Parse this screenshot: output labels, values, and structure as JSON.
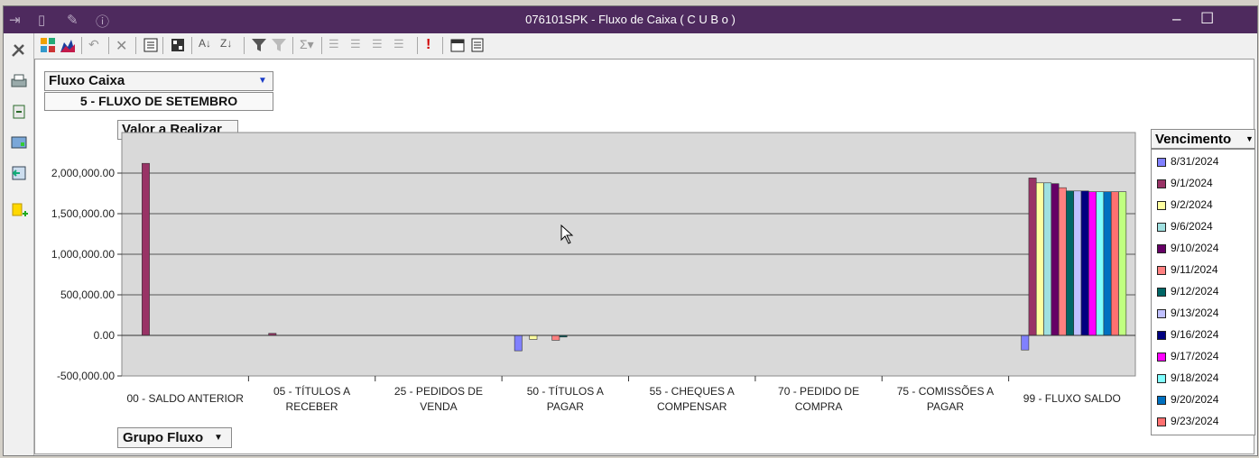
{
  "window": {
    "title": "076101SPK - Fluxo de Caixa ( C U B o )",
    "min_glyph": "–",
    "max_glyph": "☐"
  },
  "filters": {
    "field1_label": "Fluxo Caixa",
    "field1_value": "5 - FLUXO DE SETEMBRO",
    "data_field_label": "Valor a Realizar",
    "category_field_label": "Grupo Fluxo",
    "series_field_label": "Vencimento"
  },
  "colors": {
    "titlebar": "#4e2a5e",
    "plot_background": "#d9d9d9"
  },
  "chart_data": {
    "type": "bar",
    "ylim": [
      -500000,
      2500000
    ],
    "y_ticks": [
      -500000,
      0,
      500000,
      1000000,
      1500000,
      2000000
    ],
    "y_tick_labels": [
      "-500,000.00",
      "0.00",
      "500,000.00",
      "1,000,000.00",
      "1,500,000.00",
      "2,000,000.00"
    ],
    "grid": true,
    "legend_position": "right",
    "categories": [
      [
        "00  - SALDO ANTERIOR"
      ],
      [
        "05  - TÍTULOS A",
        "RECEBER"
      ],
      [
        "25  - PEDIDOS DE",
        "VENDA"
      ],
      [
        "50  - TÍTULOS A",
        "PAGAR"
      ],
      [
        "55  - CHEQUES A",
        "COMPENSAR"
      ],
      [
        "70  - PEDIDO DE",
        "COMPRA"
      ],
      [
        "75  - COMISSÕES A",
        "PAGAR"
      ],
      [
        "99  - FLUXO SALDO"
      ]
    ],
    "series": [
      {
        "name": "8/31/2024",
        "color": "#8080ff",
        "values": [
          null,
          null,
          null,
          -190000,
          null,
          null,
          null,
          -180000
        ]
      },
      {
        "name": "9/1/2024",
        "color": "#993366",
        "values": [
          2120000,
          25000,
          null,
          null,
          null,
          null,
          null,
          1940000
        ]
      },
      {
        "name": "9/2/2024",
        "color": "#ffffa0",
        "values": [
          null,
          null,
          null,
          -50000,
          null,
          null,
          null,
          1880000
        ]
      },
      {
        "name": "9/6/2024",
        "color": "#a0e0e0",
        "values": [
          null,
          null,
          null,
          null,
          null,
          null,
          null,
          1880000
        ]
      },
      {
        "name": "9/10/2024",
        "color": "#660066",
        "values": [
          null,
          null,
          null,
          null,
          null,
          null,
          null,
          1870000
        ]
      },
      {
        "name": "9/11/2024",
        "color": "#ff8080",
        "values": [
          null,
          null,
          null,
          -60000,
          null,
          null,
          null,
          1820000
        ]
      },
      {
        "name": "9/12/2024",
        "color": "#006666",
        "values": [
          null,
          null,
          null,
          -20000,
          null,
          null,
          null,
          1780000
        ]
      },
      {
        "name": "9/13/2024",
        "color": "#c0c0ff",
        "values": [
          null,
          null,
          null,
          null,
          null,
          null,
          null,
          1780000
        ]
      },
      {
        "name": "9/16/2024",
        "color": "#000080",
        "values": [
          null,
          null,
          null,
          null,
          null,
          null,
          null,
          1780000
        ]
      },
      {
        "name": "9/17/2024",
        "color": "#ff00ff",
        "values": [
          null,
          null,
          null,
          null,
          null,
          null,
          null,
          1770000
        ]
      },
      {
        "name": "9/18/2024",
        "color": "#80ffff",
        "values": [
          null,
          null,
          null,
          null,
          null,
          null,
          null,
          1770000
        ]
      },
      {
        "name": "9/20/2024",
        "color": "#0070c0",
        "values": [
          null,
          null,
          null,
          null,
          null,
          null,
          null,
          1770000
        ]
      },
      {
        "name": "9/23/2024",
        "color": "#ff7070",
        "values": [
          null,
          null,
          null,
          null,
          null,
          null,
          null,
          1770000
        ]
      },
      {
        "name": "",
        "color": "#c0ff80",
        "values": [
          null,
          null,
          null,
          null,
          null,
          null,
          null,
          1770000
        ]
      }
    ]
  }
}
